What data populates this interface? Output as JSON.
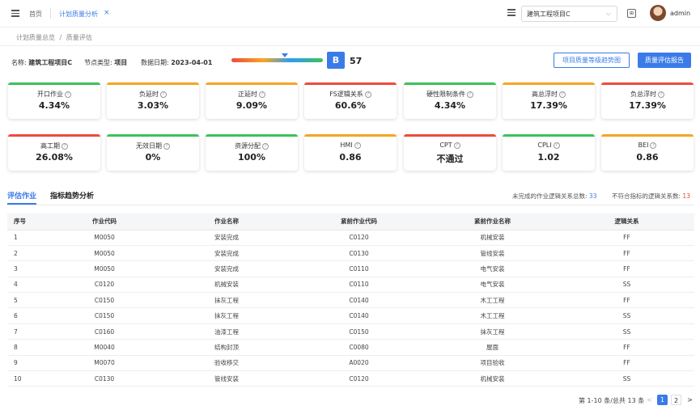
{
  "nav": {
    "home_label": "首页",
    "active_tab": "计划质量分析",
    "close_icon": "×",
    "project_select": "建筑工程项目C",
    "user_name": "admin"
  },
  "breadcrumb": {
    "parent": "计划质量总览",
    "separator": "/",
    "current": "质量评估"
  },
  "info": {
    "name_label": "名称:",
    "name_value": "建筑工程项目C",
    "node_label": "节点类型:",
    "node_value": "项目",
    "date_label": "数据日期:",
    "date_value": "2023-04-01",
    "gauge_level": 0.58,
    "grade": "B",
    "score": "57"
  },
  "actions": {
    "trend_button": "项目质量等级趋势图",
    "report_button": "质量评估报告"
  },
  "metrics_row1": [
    {
      "label": "开口作业",
      "value": "4.34%",
      "color": "#3ec25a"
    },
    {
      "label": "负延时",
      "value": "3.03%",
      "color": "#f5a623"
    },
    {
      "label": "正延时",
      "value": "9.09%",
      "color": "#f5a623"
    },
    {
      "label": "FS逻辑关系",
      "value": "60.6%",
      "color": "#ef4b3c"
    },
    {
      "label": "硬性限制条件",
      "value": "4.34%",
      "color": "#3ec25a"
    },
    {
      "label": "高总浮时",
      "value": "17.39%",
      "color": "#f5a623"
    },
    {
      "label": "负总浮时",
      "value": "17.39%",
      "color": "#ef4b3c"
    }
  ],
  "metrics_row2": [
    {
      "label": "高工期",
      "value": "26.08%",
      "color": "#ef4b3c"
    },
    {
      "label": "无效日期",
      "value": "0%",
      "color": "#3ec25a"
    },
    {
      "label": "资源分配",
      "value": "100%",
      "color": "#3ec25a"
    },
    {
      "label": "HMI",
      "value": "0.86",
      "color": "#f5a623"
    },
    {
      "label": "CPT",
      "value": "不通过",
      "color": "#ef4b3c"
    },
    {
      "label": "CPLI",
      "value": "1.02",
      "color": "#3ec25a"
    },
    {
      "label": "BEI",
      "value": "0.86",
      "color": "#f5a623"
    }
  ],
  "tabs": {
    "eval": "评估作业",
    "trend": "指标趋势分析"
  },
  "stats": {
    "unfinished_label": "未完成的作业逻辑关系总数:",
    "unfinished_value": "33",
    "noncompliant_label": "不符合指标的逻辑关系数:",
    "noncompliant_value": "13"
  },
  "table": {
    "headers": [
      "序号",
      "作业代码",
      "作业名称",
      "紧前作业代码",
      "紧前作业名称",
      "逻辑关系"
    ],
    "rows": [
      [
        "1",
        "M0050",
        "安装完成",
        "C0120",
        "机械安装",
        "FF"
      ],
      [
        "2",
        "M0050",
        "安装完成",
        "C0130",
        "管线安装",
        "FF"
      ],
      [
        "3",
        "M0050",
        "安装完成",
        "C0110",
        "电气安装",
        "FF"
      ],
      [
        "4",
        "C0120",
        "机械安装",
        "C0110",
        "电气安装",
        "SS"
      ],
      [
        "5",
        "C0150",
        "抹灰工程",
        "C0140",
        "木工工程",
        "FF"
      ],
      [
        "6",
        "C0150",
        "抹灰工程",
        "C0140",
        "木工工程",
        "SS"
      ],
      [
        "7",
        "C0160",
        "油漆工程",
        "C0150",
        "抹灰工程",
        "SS"
      ],
      [
        "8",
        "M0040",
        "结构封顶",
        "C0080",
        "屋面",
        "FF"
      ],
      [
        "9",
        "M0070",
        "验收移交",
        "A0020",
        "项目验收",
        "FF"
      ],
      [
        "10",
        "C0130",
        "管线安装",
        "C0120",
        "机械安装",
        "SS"
      ]
    ]
  },
  "pagination": {
    "summary": "第 1-10 条/总共 13 条",
    "prev": "<",
    "page1": "1",
    "page2": "2",
    "next": ">"
  }
}
